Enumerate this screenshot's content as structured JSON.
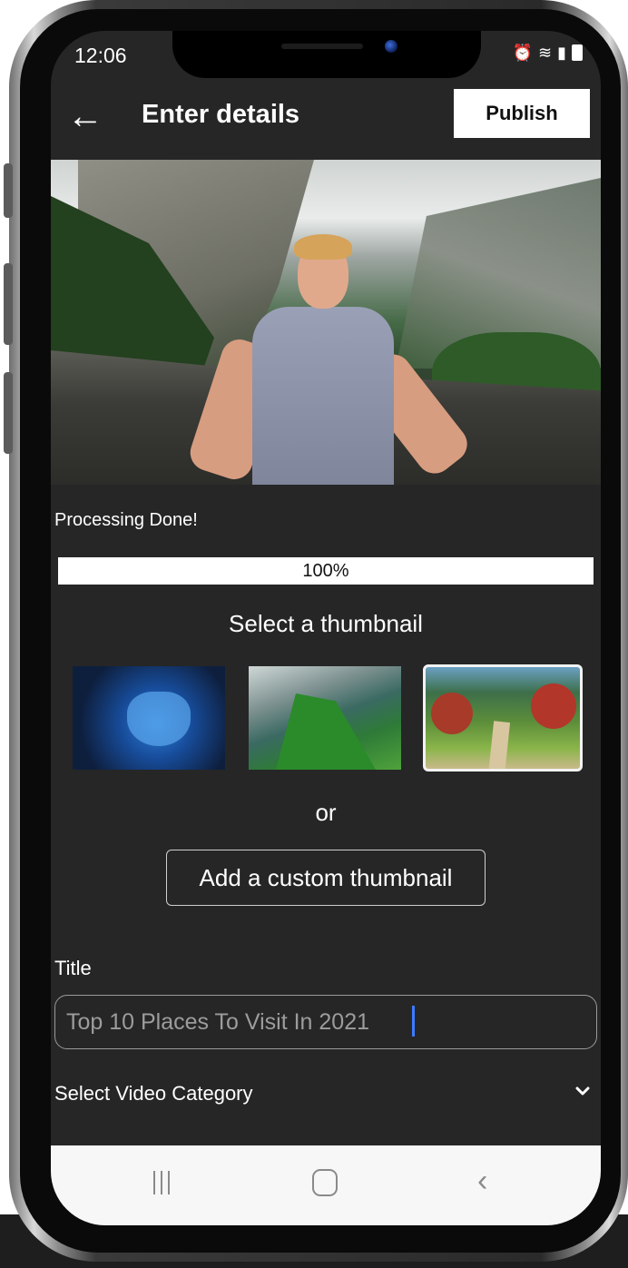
{
  "status_bar": {
    "time": "12:06"
  },
  "header": {
    "back_icon": "arrow-left-icon",
    "title": "Enter details",
    "publish_label": "Publish"
  },
  "video": {
    "description_icon": "video-preview"
  },
  "processing": {
    "label": "Processing Done!",
    "progress_text": "100%",
    "progress_fraction": 1.0
  },
  "thumbnails": {
    "heading": "Select a thumbnail",
    "selected_index": 2,
    "or_text": "or",
    "custom_button_label": "Add a custom thumbnail"
  },
  "title_field": {
    "label": "Title",
    "value": "Top 10 Places To Visit In 2021"
  },
  "category": {
    "label": "Select Video Category",
    "icon": "chevron-down-icon"
  },
  "colors": {
    "screen_bg": "#262626",
    "selected_border": "#f2f2f2",
    "caret": "#3d7bff"
  }
}
